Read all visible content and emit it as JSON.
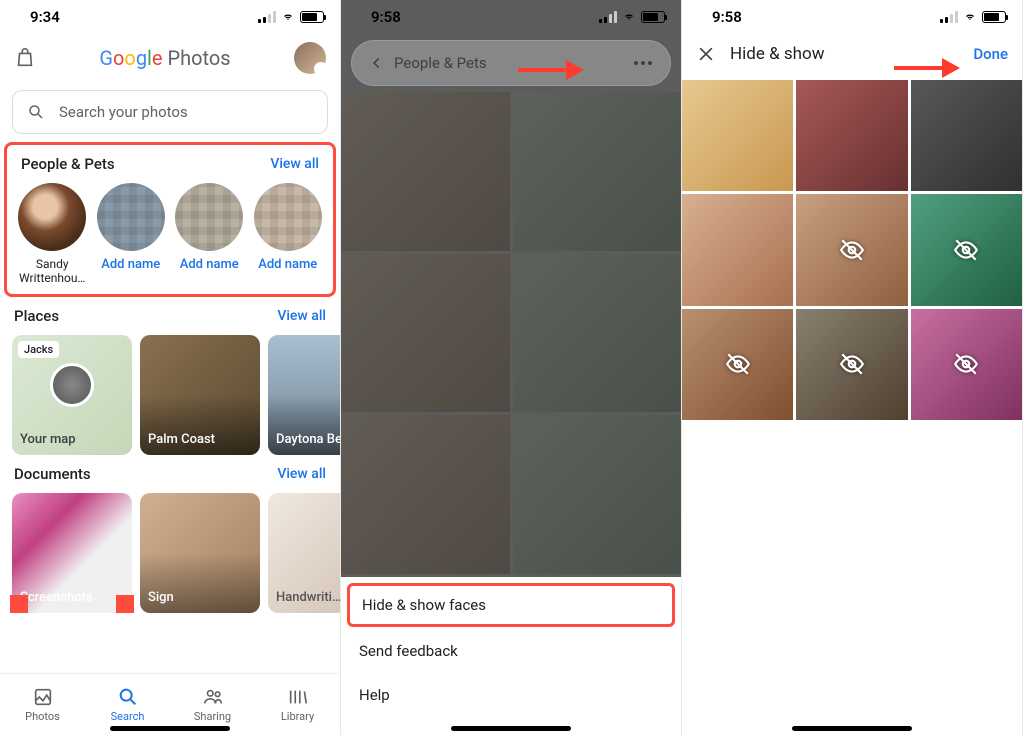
{
  "panel1": {
    "time": "9:34",
    "app_logo_text": "Photos",
    "search_placeholder": "Search your photos",
    "people_pets": {
      "title": "People & Pets",
      "view_all": "View all",
      "faces": [
        {
          "label": "Sandy Writtenhou…"
        },
        {
          "link": "Add name"
        },
        {
          "link": "Add name"
        },
        {
          "link": "Add name"
        }
      ]
    },
    "places": {
      "title": "Places",
      "view_all": "View all",
      "map_tag": "Jacks",
      "map_label": "Your map",
      "items": [
        "Palm Coast",
        "Daytona Be…"
      ]
    },
    "documents": {
      "title": "Documents",
      "view_all": "View all",
      "items": [
        "Screenshots",
        "Sign",
        "Handwriti…"
      ]
    },
    "tabs": {
      "photos": "Photos",
      "search": "Search",
      "sharing": "Sharing",
      "library": "Library"
    }
  },
  "panel2": {
    "time": "9:58",
    "title": "People & Pets",
    "menu": {
      "hide_show": "Hide & show faces",
      "feedback": "Send feedback",
      "help": "Help"
    }
  },
  "panel3": {
    "time": "9:58",
    "title": "Hide & show",
    "done": "Done"
  }
}
